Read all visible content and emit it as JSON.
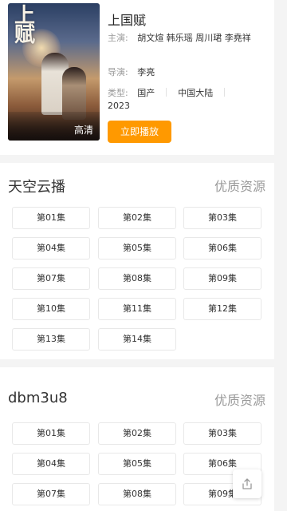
{
  "movie": {
    "title": "上国赋",
    "poster_calligraphy": "上\n赋",
    "poster_badge": "高清",
    "cast_label": "主演:",
    "cast": "胡文煊 韩乐瑶 周川珺 李堯祥",
    "director_label": "导演:",
    "director": "李亮",
    "type_label": "类型:",
    "type": "国产",
    "region": "中国大陆",
    "year": "2023",
    "play_label": "立即播放"
  },
  "sources": [
    {
      "name": "天空云播",
      "tag": "优质资源",
      "episodes": [
        "第01集",
        "第02集",
        "第03集",
        "第04集",
        "第05集",
        "第06集",
        "第07集",
        "第08集",
        "第09集",
        "第10集",
        "第11集",
        "第12集",
        "第13集",
        "第14集"
      ]
    },
    {
      "name": "dbm3u8",
      "tag": "优质资源",
      "episodes": [
        "第01集",
        "第02集",
        "第03集",
        "第04集",
        "第05集",
        "第06集",
        "第07集",
        "第08集",
        "第09集"
      ]
    }
  ],
  "icons": {
    "share": "share-icon"
  },
  "colors": {
    "accent": "#ff9900",
    "muted": "#999999"
  }
}
